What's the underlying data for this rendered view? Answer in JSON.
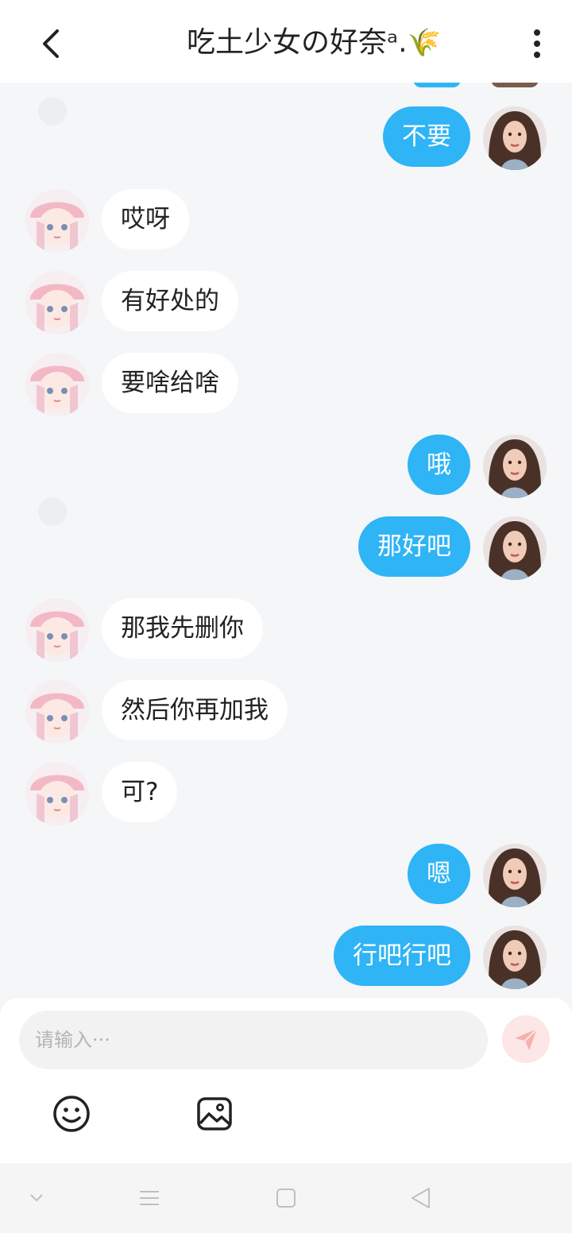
{
  "header": {
    "title": "吃土少女の好奈ᵃ.",
    "title_decoration": "🌾"
  },
  "messages": [
    {
      "side": "out",
      "text": "不要",
      "avatar": "girl-dark-hair-avatar"
    },
    {
      "side": "in",
      "text": "哎呀",
      "avatar": "anime-girl-pink-hat-avatar"
    },
    {
      "side": "in",
      "text": "有好处的",
      "avatar": "anime-girl-pink-hat-avatar"
    },
    {
      "side": "in",
      "text": "要啥给啥",
      "avatar": "anime-girl-pink-hat-avatar"
    },
    {
      "side": "out",
      "text": "哦",
      "avatar": "girl-dark-hair-avatar"
    },
    {
      "side": "out",
      "text": "那好吧",
      "avatar": "girl-dark-hair-avatar"
    },
    {
      "side": "in",
      "text": "那我先删你",
      "avatar": "anime-girl-pink-hat-avatar"
    },
    {
      "side": "in",
      "text": "然后你再加我",
      "avatar": "anime-girl-pink-hat-avatar"
    },
    {
      "side": "in",
      "text": "可?",
      "avatar": "anime-girl-pink-hat-avatar"
    },
    {
      "side": "out",
      "text": "嗯",
      "avatar": "girl-dark-hair-avatar"
    },
    {
      "side": "out",
      "text": "行吧行吧",
      "avatar": "girl-dark-hair-avatar"
    }
  ],
  "composer": {
    "placeholder": "请输入···",
    "value": ""
  },
  "icons": {
    "back": "chevron-left-icon",
    "more": "more-vertical-icon",
    "send": "paper-plane-icon",
    "emoji": "smiley-icon",
    "image": "image-icon",
    "nav": [
      "chevron-down-icon",
      "menu-icon",
      "square-icon",
      "triangle-back-icon"
    ]
  },
  "colors": {
    "outgoing_bubble": "#2fb4f5",
    "incoming_bubble": "#ffffff",
    "background": "#f4f6f8",
    "send_button": "#fde6e6",
    "send_icon": "#f6b0b0"
  }
}
